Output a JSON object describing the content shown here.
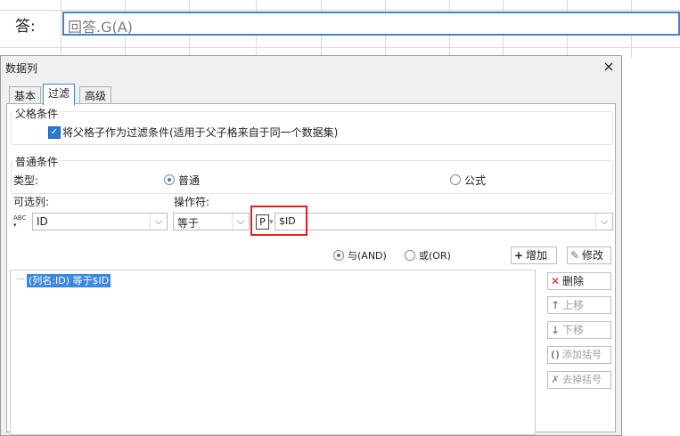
{
  "sheet": {
    "answer_label": "答:",
    "formula": "回答.G(A)"
  },
  "dialog": {
    "title": "数据列",
    "close_icon": "×",
    "tabs": [
      {
        "label": "基本",
        "active": false
      },
      {
        "label": "过滤",
        "active": true
      },
      {
        "label": "高级",
        "active": false
      }
    ],
    "parent_condition": {
      "group_label": "父格条件",
      "checkbox_label": "将父格子作为过滤条件(适用于父子格来自于同一个数据集)",
      "checked": true
    },
    "normal_condition": {
      "group_label": "普通条件",
      "type_label": "类型:",
      "radio_normal": "普通",
      "radio_formula": "公式",
      "selected": "普通",
      "column_label": "可选列:",
      "operator_label": "操作符:",
      "column_value": "ID",
      "operator_value": "等于",
      "param_icon": "P",
      "param_value": "$ID",
      "and_label": "与(AND)",
      "or_label": "或(OR)",
      "logic_selected": "AND",
      "add_button": "增加",
      "edit_button": "修改"
    },
    "conditions": [
      "(列名:ID) 等于$ID"
    ],
    "side_buttons": {
      "delete": "删除",
      "move_up": "上移",
      "move_down": "下移",
      "add_bracket": "添加括号",
      "remove_bracket": "去掉括号"
    }
  },
  "colors": {
    "accent": "#2b79d8",
    "highlight_border": "#e02020",
    "selected_item": "#3c88df"
  }
}
